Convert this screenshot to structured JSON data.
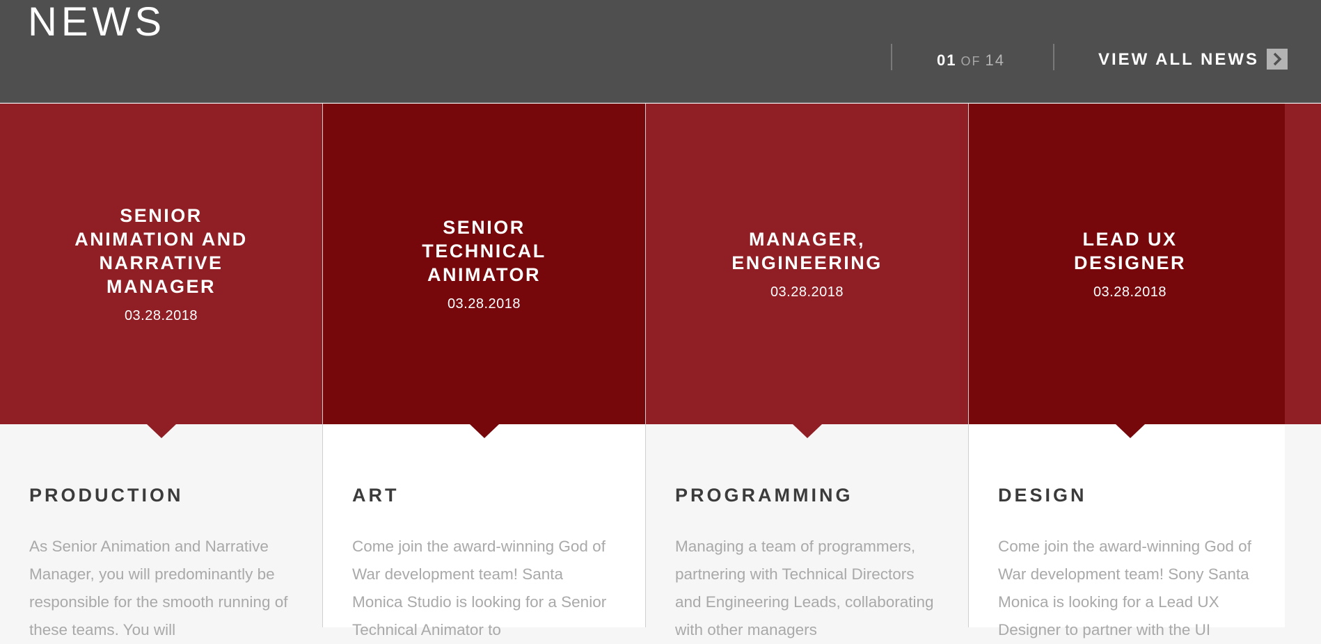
{
  "header": {
    "title": "NEWS",
    "pager_current": "01",
    "pager_of": "OF",
    "pager_total": "14",
    "view_all_label": "VIEW ALL NEWS",
    "view_all_icon": "chevron-right-icon"
  },
  "colors": {
    "header_bg": "#4f4f4f",
    "card_red": "#8f1f25",
    "card_dark_red": "#76080c"
  },
  "cards": [
    {
      "title": "SENIOR ANIMATION AND NARRATIVE MANAGER",
      "date": "03.28.2018",
      "category": "PRODUCTION",
      "description": "As Senior Animation and Narrative Manager, you will predominantly be responsible for the smooth running of these teams. You will"
    },
    {
      "title": "SENIOR TECHNICAL ANIMATOR",
      "date": "03.28.2018",
      "category": "ART",
      "description": "Come join the award-winning God of War development team! Santa Monica Studio is looking for a Senior Technical Animator to"
    },
    {
      "title": "MANAGER, ENGINEERING",
      "date": "03.28.2018",
      "category": "PROGRAMMING",
      "description": "Managing a team of programmers, partnering with Technical Directors and Engineering Leads, collaborating with other managers"
    },
    {
      "title": "LEAD UX DESIGNER",
      "date": "03.28.2018",
      "category": "DESIGN",
      "description": "Come join the award-winning God of War development team! Sony Santa Monica is looking for a Lead UX Designer to partner with the UI"
    }
  ]
}
